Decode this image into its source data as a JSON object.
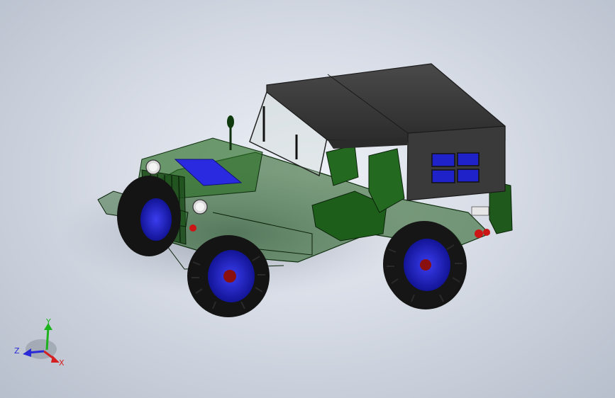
{
  "triad": {
    "x_label": "X",
    "y_label": "Y",
    "z_label": "Z",
    "x_color": "#d42020",
    "y_color": "#1db31d",
    "z_color": "#2a2ad6"
  },
  "model": {
    "body_color": "#1f5a1c",
    "top_color": "#3b3b3b",
    "wheel_hub_color": "#1f21c9",
    "tire_color": "#141414",
    "hood_panel_color": "#2a2ae0",
    "light_color": "#cc1515"
  }
}
